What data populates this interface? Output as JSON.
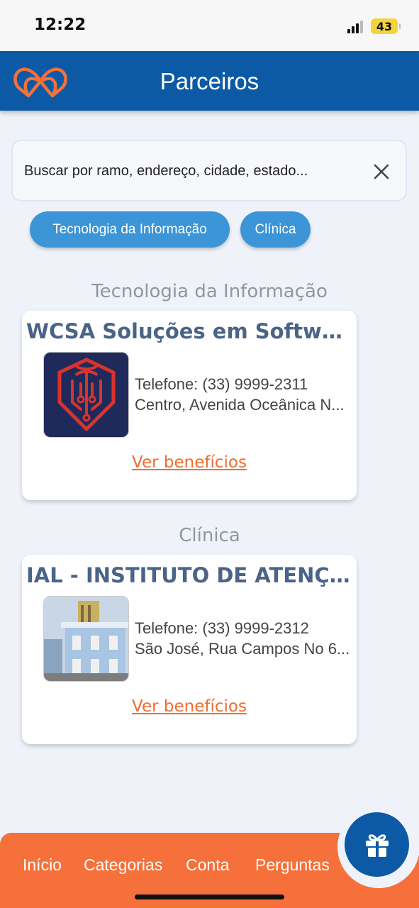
{
  "status_bar": {
    "time": "12:22",
    "battery": "43"
  },
  "header": {
    "title": "Parceiros"
  },
  "search": {
    "placeholder": "Buscar por ramo, endereço, cidade, estado..."
  },
  "filters": [
    {
      "label": "Tecnologia da Informação"
    },
    {
      "label": "Clínica"
    }
  ],
  "sections": [
    {
      "heading": "Tecnologia da Informação",
      "card": {
        "title": "WCSA Soluções em Software",
        "phone": "Telefone: (33) 9999-2311",
        "address": "Centro, Avenida Oceânica N...",
        "link": "Ver benefícios"
      }
    },
    {
      "heading": "Clínica",
      "card": {
        "title": "IAL - INSTITUTO DE ATENÇÃO ...",
        "phone": "Telefone: (33) 9999-2312",
        "address": "São José, Rua Campos No 6...",
        "link": "Ver benefícios"
      }
    }
  ],
  "bottom_nav": [
    {
      "label": "Início"
    },
    {
      "label": "Categorias"
    },
    {
      "label": "Conta"
    },
    {
      "label": "Perguntas"
    }
  ],
  "icons": {
    "logo": "heart-link-logo",
    "clear": "close-icon",
    "fab": "gift-icon"
  },
  "colors": {
    "primary": "#0c5aa6",
    "accent": "#f5703a",
    "chip": "#3b95d6",
    "card_title": "#4a6488",
    "link": "#f26b2f"
  }
}
